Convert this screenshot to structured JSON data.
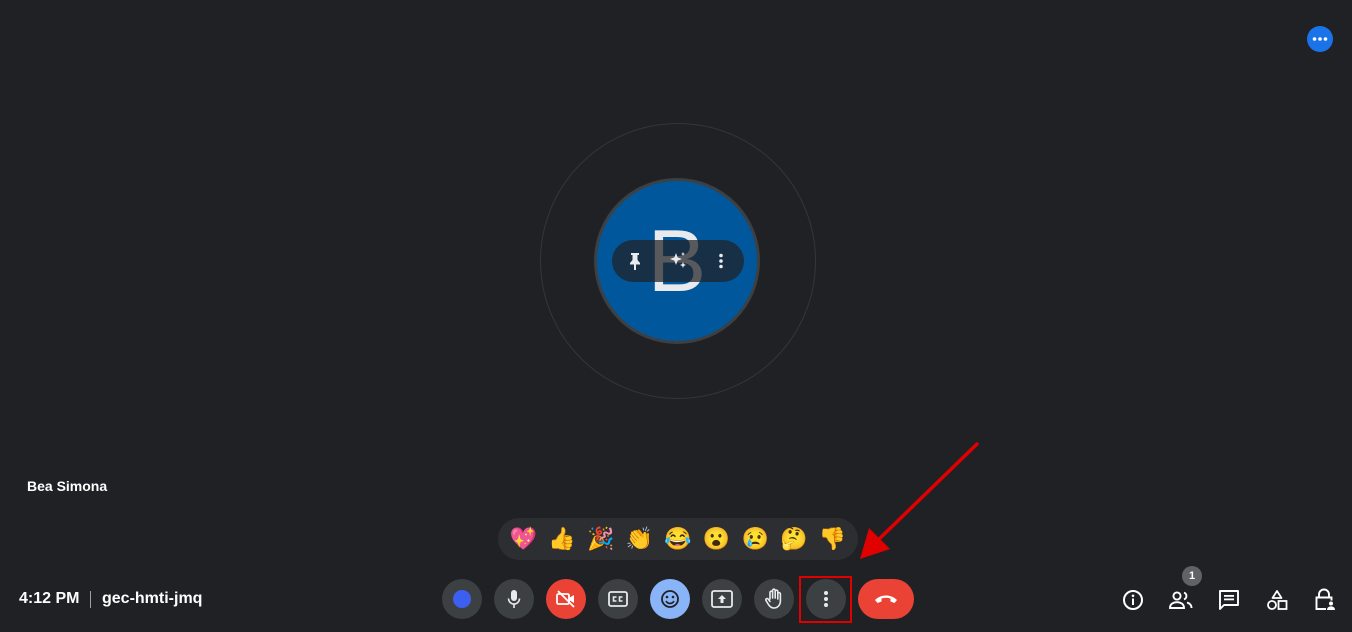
{
  "participant": {
    "name": "Bea Simona",
    "initial": "B",
    "avatar_color": "#01579b"
  },
  "tile_controls": [
    {
      "name": "pin-icon"
    },
    {
      "name": "visual-effects-icon"
    },
    {
      "name": "more-options-icon"
    }
  ],
  "reactions": [
    "💖",
    "👍",
    "🎉",
    "👏",
    "😂",
    "😮",
    "😢",
    "🤔",
    "👎"
  ],
  "meeting": {
    "time": "4:12 PM",
    "code": "gec-hmti-jmq"
  },
  "controls": [
    {
      "name": "record-indicator",
      "icon": "dot-icon"
    },
    {
      "name": "microphone",
      "icon": "mic-icon"
    },
    {
      "name": "camera-off",
      "icon": "videocam-off-icon",
      "color": "#ea4335"
    },
    {
      "name": "captions",
      "icon": "cc-icon"
    },
    {
      "name": "reactions",
      "icon": "emoji-icon",
      "color": "#8ab4f8"
    },
    {
      "name": "present",
      "icon": "present-screen-icon"
    },
    {
      "name": "raise-hand",
      "icon": "hand-icon"
    },
    {
      "name": "more-options",
      "icon": "more-vert-icon"
    },
    {
      "name": "leave-call",
      "icon": "call-end-icon",
      "color": "#ea4335"
    }
  ],
  "right_controls": [
    {
      "name": "meeting-details",
      "icon": "info-icon"
    },
    {
      "name": "people",
      "icon": "people-icon",
      "badge": "1"
    },
    {
      "name": "chat",
      "icon": "chat-icon"
    },
    {
      "name": "activities",
      "icon": "shapes-icon"
    },
    {
      "name": "host-controls",
      "icon": "lock-person-icon"
    }
  ],
  "accent_color": "#1a73e8",
  "annotation_color": "#e00000"
}
